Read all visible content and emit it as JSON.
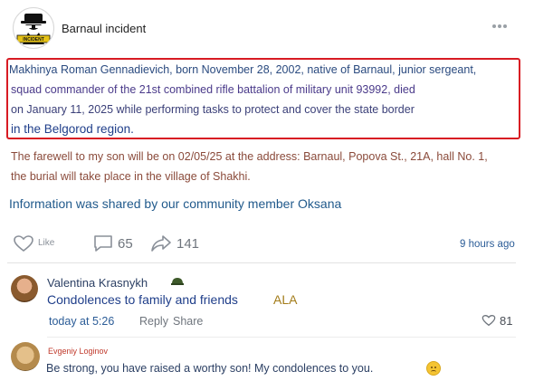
{
  "header": {
    "group_name": "Barnaul incident",
    "logo_text": "INCIDENT"
  },
  "post": {
    "lines": [
      "Makhinya Roman Gennadievich, born November 28, 2002, native of Barnaul, junior sergeant,",
      "squad commander of the 21st combined rifle battalion of military unit 93992, died",
      "on January 11, 2025 while performing tasks to protect and cover the state border",
      "in the Belgorod region."
    ],
    "farewell_lines": [
      "The farewell to my son will be on 02/05/25 at the address: Barnaul, Popova St., 21A, hall No. 1,",
      "the burial will take place in the village of Shakhi."
    ],
    "info": "Information was shared by our community member Oksana",
    "highlight_color": "#d81b23"
  },
  "actions": {
    "like_label": "Like",
    "comment_count": "65",
    "share_count": "141",
    "time_ago": "9 hours ago"
  },
  "comments": [
    {
      "name": "Valentina Krasnykh",
      "text": "Condolences to family and friends",
      "tag": "ALA",
      "time": "today at 5:26",
      "reply_label": "Reply",
      "share_label": "Share",
      "likes": "81"
    },
    {
      "name": "Evgeniy Loginov",
      "text": "Be strong, you have raised a worthy son! My condolences to you."
    }
  ],
  "icons": {
    "more": "more-dots-icon",
    "like": "heart-icon",
    "comment": "comment-icon",
    "share": "share-arrow-icon",
    "badge": "helmet-icon",
    "emoji": "sad-face-icon"
  }
}
